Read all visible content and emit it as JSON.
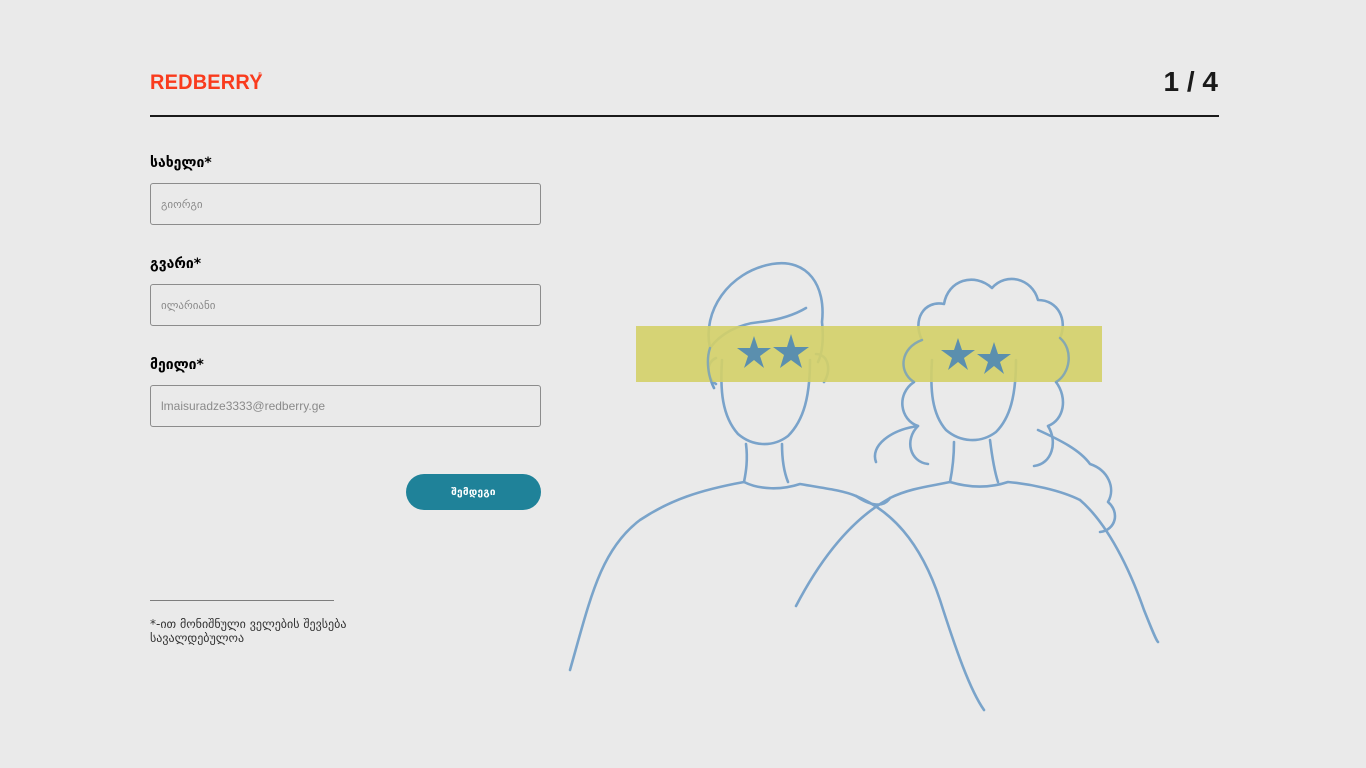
{
  "header": {
    "logo_text": "REDBERRY",
    "logo_mark": "®",
    "step_indicator": "1 / 4"
  },
  "form": {
    "first_name": {
      "label": "სახელი*",
      "placeholder": "გიორგი",
      "value": ""
    },
    "last_name": {
      "label": "გვარი*",
      "placeholder": "ილარიანი",
      "value": ""
    },
    "email": {
      "label": "მეილი*",
      "placeholder": "lmaisuradze3333@redberry.ge",
      "value": ""
    },
    "next_label": "შემდეგი"
  },
  "footer": {
    "note": "*-ით მონიშნული ველების შევსება სავალდებულოა"
  },
  "colors": {
    "brand": "#F93B1D",
    "button": "#1F8299",
    "background": "#EAEAEA",
    "illustration_line": "#6E9CC7",
    "illustration_band": "#D4D068",
    "illustration_stars": "#5B8FAE"
  },
  "illustration": {
    "icon": "two-people-star-eyes-illustration"
  }
}
